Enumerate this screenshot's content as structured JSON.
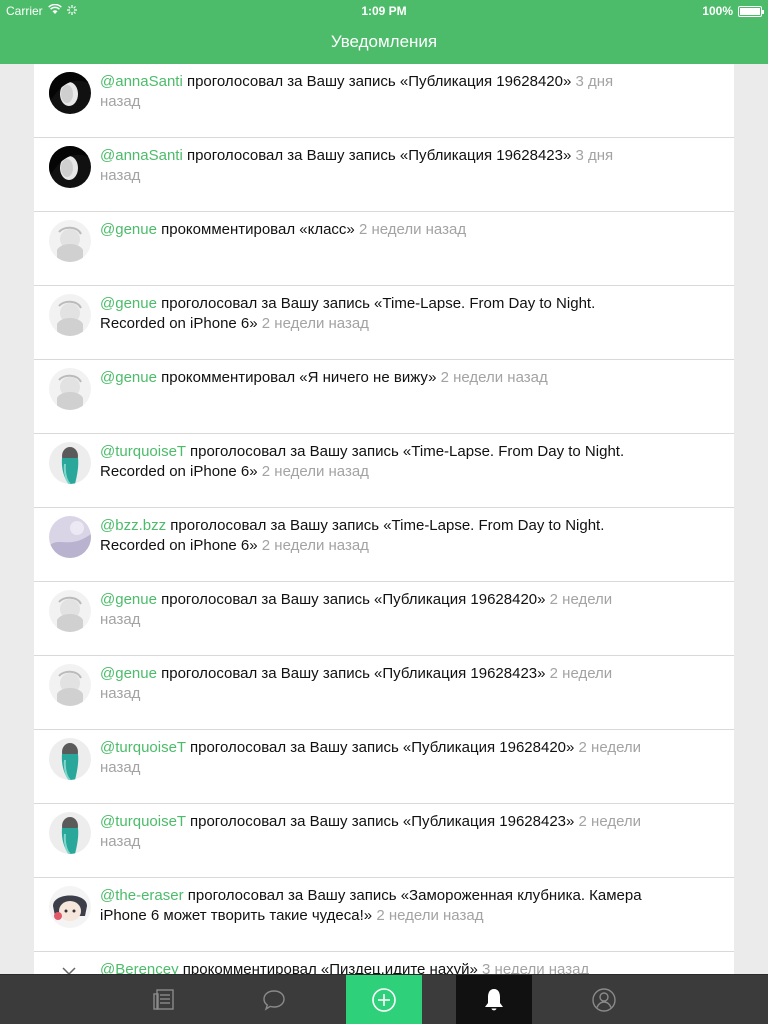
{
  "status_bar": {
    "carrier": "Carrier",
    "time": "1:09 PM",
    "battery": "100%"
  },
  "nav": {
    "title": "Уведомления"
  },
  "colors": {
    "accent": "#4cbc6a",
    "tab_add": "#2ed07a",
    "tabbar": "#3b3b3b"
  },
  "notifications": [
    {
      "user": "@annaSanti",
      "action": " проголосовал за Вашу запись «Публикация 19628420» ",
      "time": "3 дня назад",
      "avatar": "dark-portrait"
    },
    {
      "user": "@annaSanti",
      "action": " проголосовал за Вашу запись «Публикация 19628423» ",
      "time": "3 дня назад",
      "avatar": "dark-portrait"
    },
    {
      "user": "@genue",
      "action": " прокомментировал «класс» ",
      "time": "2 недели назад",
      "avatar": "light-sketch"
    },
    {
      "user": "@genue",
      "action": " проголосовал за Вашу запись «Time-Lapse. From Day to Night. Recorded on iPhone 6» ",
      "time": "2 недели назад",
      "avatar": "light-sketch"
    },
    {
      "user": "@genue",
      "action": " прокомментировал «Я ничего не вижу» ",
      "time": "2 недели назад",
      "avatar": "light-sketch"
    },
    {
      "user": "@turquoiseT",
      "action": " проголосовал за Вашу запись «Time-Lapse. From Day to Night. Recorded on iPhone 6» ",
      "time": "2 недели назад",
      "avatar": "teal-hair"
    },
    {
      "user": "@bzz.bzz",
      "action": " проголосовал за Вашу запись «Time-Lapse. From Day to Night. Recorded on iPhone 6» ",
      "time": "2 недели назад",
      "avatar": "lavender"
    },
    {
      "user": "@genue",
      "action": " проголосовал за Вашу запись «Публикация 19628420» ",
      "time": "2 недели назад",
      "avatar": "light-sketch"
    },
    {
      "user": "@genue",
      "action": " проголосовал за Вашу запись «Публикация 19628423» ",
      "time": "2 недели назад",
      "avatar": "light-sketch"
    },
    {
      "user": "@turquoiseT",
      "action": " проголосовал за Вашу запись «Публикация 19628420» ",
      "time": "2 недели назад",
      "avatar": "teal-hair"
    },
    {
      "user": "@turquoiseT",
      "action": " проголосовал за Вашу запись «Публикация 19628423» ",
      "time": "2 недели назад",
      "avatar": "teal-hair"
    },
    {
      "user": "@the-eraser",
      "action": " проголосовал за Вашу запись «Замороженная клубника. Камера iPhone 6 может творить такие чудеса!» ",
      "time": "2 недели назад",
      "avatar": "anime-girl"
    },
    {
      "user": "@Berencey",
      "action": " прокомментировал «Пиздец,идите нахуй» ",
      "time": "3 недели назад",
      "avatar": "doodle"
    }
  ],
  "tabbar": {
    "tabs": [
      {
        "icon": "feed-icon"
      },
      {
        "icon": "comment-icon"
      },
      {
        "icon": "add-icon"
      },
      {
        "icon": "bell-icon",
        "active": true
      },
      {
        "icon": "profile-icon"
      }
    ]
  }
}
